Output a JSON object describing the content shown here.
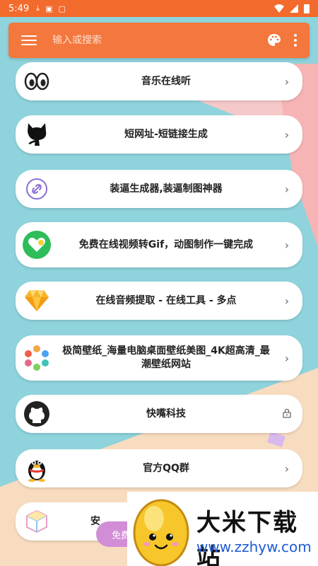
{
  "status_bar": {
    "time": "5:49",
    "icons": [
      "download-icon",
      "image-icon",
      "notification-icon",
      "wifi-icon",
      "signal-icon",
      "battery-icon"
    ]
  },
  "top_bar": {
    "search_placeholder": "输入或搜索",
    "menu_icon": "hamburger-menu-icon",
    "palette_icon": "palette-icon",
    "more_icon": "more-vertical-icon",
    "color": "#f4773d"
  },
  "items": [
    {
      "icon": "eyes-icon",
      "label": "音乐在线听",
      "trail": "›"
    },
    {
      "icon": "github-cat-icon",
      "label": "短网址-短链接生成",
      "trail": "›"
    },
    {
      "icon": "link-circle-icon",
      "label": "装逼生成器,装逼制图神器",
      "trail": "›"
    },
    {
      "icon": "green-heart-icon",
      "label": "免费在线视频转Gif，动图制作一键完成",
      "trail": "›"
    },
    {
      "icon": "sketch-diamond-icon",
      "label": "在线音频提取 - 在线工具 - 多点",
      "trail": "›"
    },
    {
      "icon": "color-ring-icon",
      "label": "极简壁纸_海量电脑桌面壁纸美图_4K超高清_最潮壁纸网站",
      "trail": "›"
    },
    {
      "icon": "github-icon",
      "label": "快嘴科技",
      "trail": "lock-icon"
    },
    {
      "icon": "qq-penguin-icon",
      "label": "官方QQ群",
      "trail": "›"
    },
    {
      "icon": "cube-icon",
      "label": "安",
      "trail": ""
    }
  ],
  "floating_button": {
    "label": "免费"
  },
  "watermark": {
    "title": "大米下载站",
    "url": "www.zzhyw.com"
  }
}
